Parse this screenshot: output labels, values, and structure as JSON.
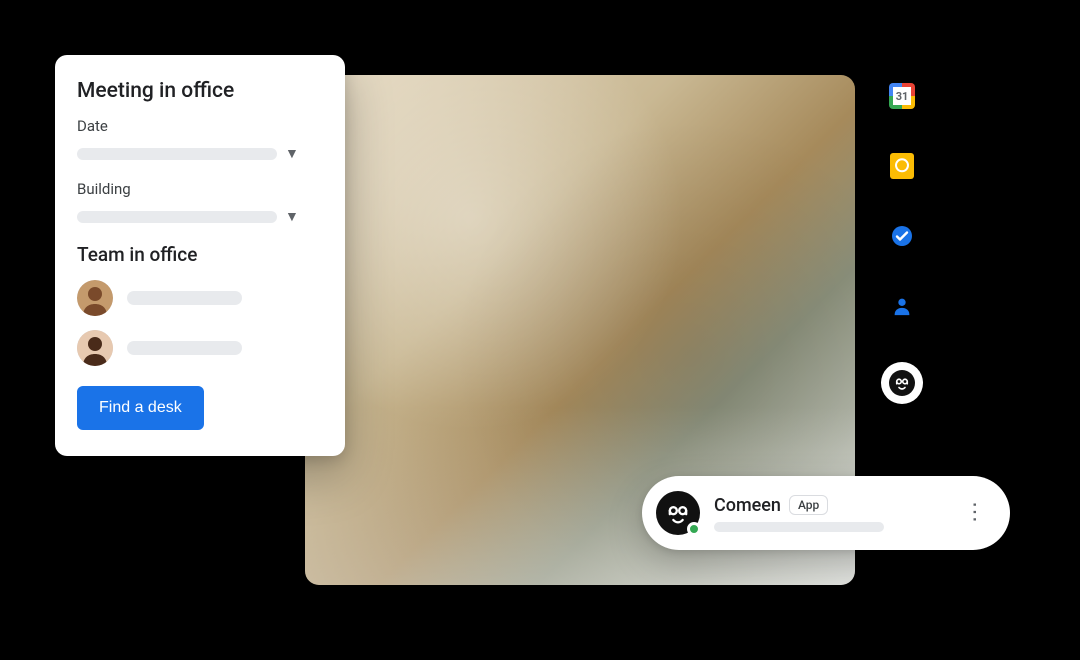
{
  "card": {
    "title": "Meeting in office",
    "fields": {
      "date_label": "Date",
      "building_label": "Building"
    },
    "team_section_title": "Team in office",
    "cta_label": "Find a desk"
  },
  "side_rail": {
    "calendar": {
      "name": "calendar-icon",
      "day_number": "31"
    },
    "keep": {
      "name": "keep-icon"
    },
    "tasks": {
      "name": "tasks-icon"
    },
    "contacts": {
      "name": "contacts-icon"
    },
    "comeen": {
      "name": "comeen-app-icon"
    }
  },
  "chat_chip": {
    "app_name": "Comeen",
    "badge_label": "App",
    "presence": "online"
  },
  "colors": {
    "primary": "#1a73e8",
    "google_blue": "#4285f4",
    "google_red": "#ea4335",
    "google_yellow": "#fbbc04",
    "google_green": "#34a853"
  }
}
